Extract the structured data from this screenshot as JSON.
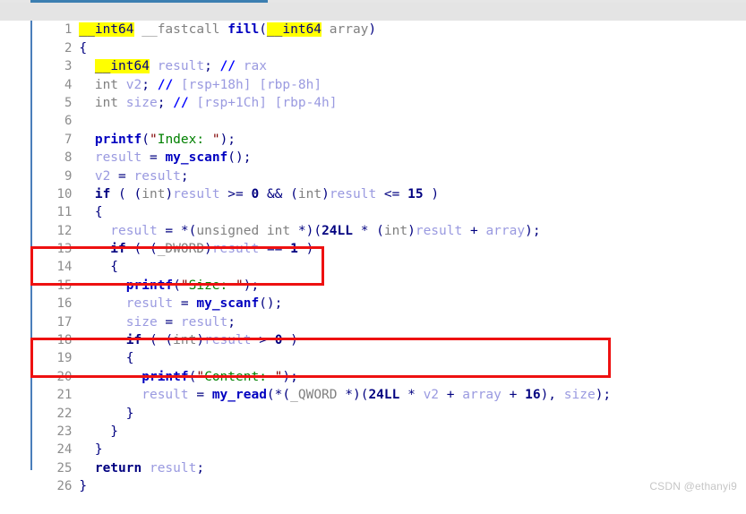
{
  "editor": {
    "name": "hex-rays-pseudocode-view",
    "current_line": 1,
    "gutter_rule_color": "#4a7ebb",
    "current_line_bg": "#e4e4e4",
    "highlight_color": "#ffff00",
    "annotation_color": "#ee1111",
    "lines": [
      {
        "n": "1",
        "text": "__int64 __fastcall fill(__int64 array)"
      },
      {
        "n": "2",
        "text": "{"
      },
      {
        "n": "3",
        "text": "  __int64 result; // rax"
      },
      {
        "n": "4",
        "text": "  int v2; // [rsp+18h] [rbp-8h]"
      },
      {
        "n": "5",
        "text": "  int size; // [rsp+1Ch] [rbp-4h]"
      },
      {
        "n": "6",
        "text": ""
      },
      {
        "n": "7",
        "text": "  printf(\"Index: \");"
      },
      {
        "n": "8",
        "text": "  result = my_scanf();"
      },
      {
        "n": "9",
        "text": "  v2 = result;"
      },
      {
        "n": "10",
        "text": "  if ( (int)result >= 0 && (int)result <= 15 )"
      },
      {
        "n": "11",
        "text": "  {"
      },
      {
        "n": "12",
        "text": "    result = *(unsigned int *)(24LL * (int)result + array);"
      },
      {
        "n": "13",
        "text": "    if ( (_DWORD)result == 1 )"
      },
      {
        "n": "14",
        "text": "    {"
      },
      {
        "n": "15",
        "text": "      printf(\"Size: \");"
      },
      {
        "n": "16",
        "text": "      result = my_scanf();"
      },
      {
        "n": "17",
        "text": "      size = result;"
      },
      {
        "n": "18",
        "text": "      if ( (int)result > 0 )"
      },
      {
        "n": "19",
        "text": "      {"
      },
      {
        "n": "20",
        "text": "        printf(\"Content: \");"
      },
      {
        "n": "21",
        "text": "        result = my_read(*(_QWORD *)(24LL * v2 + array + 16), size);"
      },
      {
        "n": "22",
        "text": "      }"
      },
      {
        "n": "23",
        "text": "    }"
      },
      {
        "n": "24",
        "text": "  }"
      },
      {
        "n": "25",
        "text": "  return result;"
      },
      {
        "n": "26",
        "text": "}"
      }
    ],
    "highlighted_tokens": [
      "__int64"
    ],
    "annotations": [
      {
        "label": "size-read-highlight-box",
        "covers_lines": "15-16"
      },
      {
        "label": "content-read-highlight-box",
        "covers_lines": "20-21"
      }
    ]
  },
  "watermark": {
    "text": "CSDN @ethanyi9"
  }
}
